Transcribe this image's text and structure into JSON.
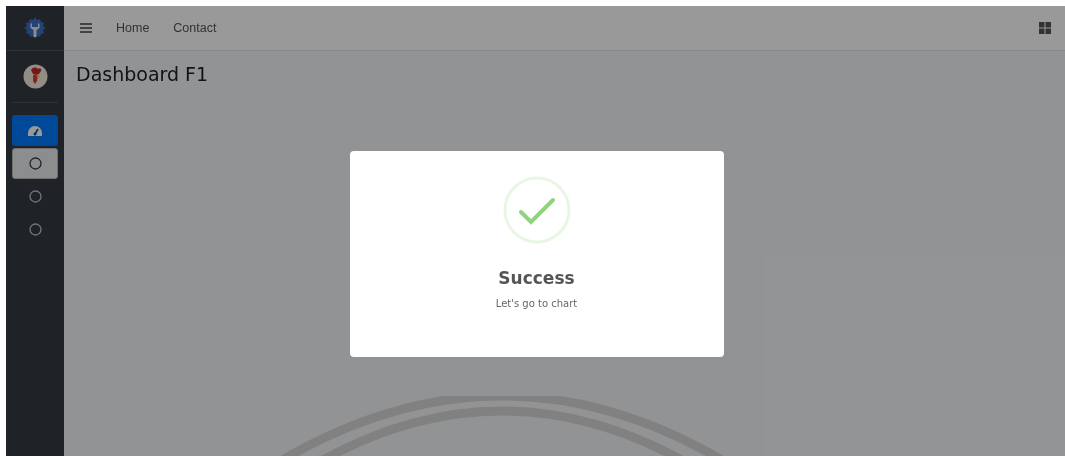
{
  "navbar": {
    "links": [
      "Home",
      "Contact"
    ]
  },
  "sidebar": {
    "items": [
      {
        "kind": "gauge",
        "selected": true,
        "focused": false
      },
      {
        "kind": "circle",
        "selected": false,
        "focused": true
      },
      {
        "kind": "circle",
        "selected": false,
        "focused": false
      },
      {
        "kind": "circle",
        "selected": false,
        "focused": false
      }
    ]
  },
  "page": {
    "title": "Dashboard F1"
  },
  "modal": {
    "title": "Success",
    "message": "Let's go to chart"
  }
}
